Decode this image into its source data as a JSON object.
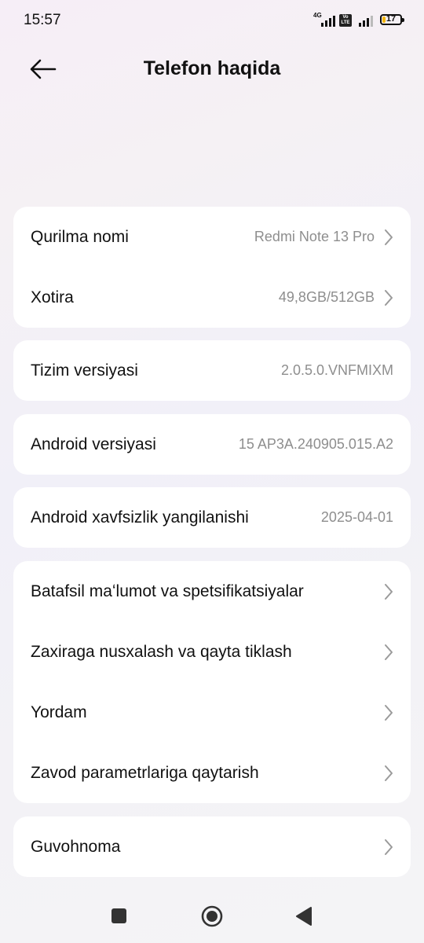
{
  "status_bar": {
    "time": "15:57",
    "network_type": "4G",
    "volte_label": "Vo LTE",
    "battery_percent": "17",
    "battery_level": 0.17
  },
  "header": {
    "title": "Telefon haqida",
    "back_icon": "arrow-left-icon"
  },
  "sections": {
    "device": {
      "name_label": "Qurilma nomi",
      "name_value": "Redmi Note 13 Pro",
      "storage_label": "Xotira",
      "storage_value": "49,8GB/512GB"
    },
    "system": {
      "label": "Tizim versiyasi",
      "value": "2.0.5.0.VNFMIXM"
    },
    "android": {
      "label": "Android versiyasi",
      "value": "15 AP3A.240905.015.A2"
    },
    "security": {
      "label": "Android xavfsizlik yangilanishi",
      "value": "2025-04-01"
    },
    "more": {
      "details": "Batafsil maʻlumot va spetsifikatsiyalar",
      "backup": "Zaxiraga nusxalash va qayta tiklash",
      "help": "Yordam",
      "factory_reset": "Zavod parametrlariga qaytarish"
    },
    "certificate": {
      "label": "Guvohnoma"
    }
  },
  "nav_bar": {
    "icons": [
      "recents-square-icon",
      "home-circle-icon",
      "back-triangle-icon"
    ]
  },
  "colors": {
    "card_bg": "#ffffff",
    "value_text": "#8e8e8e",
    "battery_fill": "#f2b400"
  }
}
